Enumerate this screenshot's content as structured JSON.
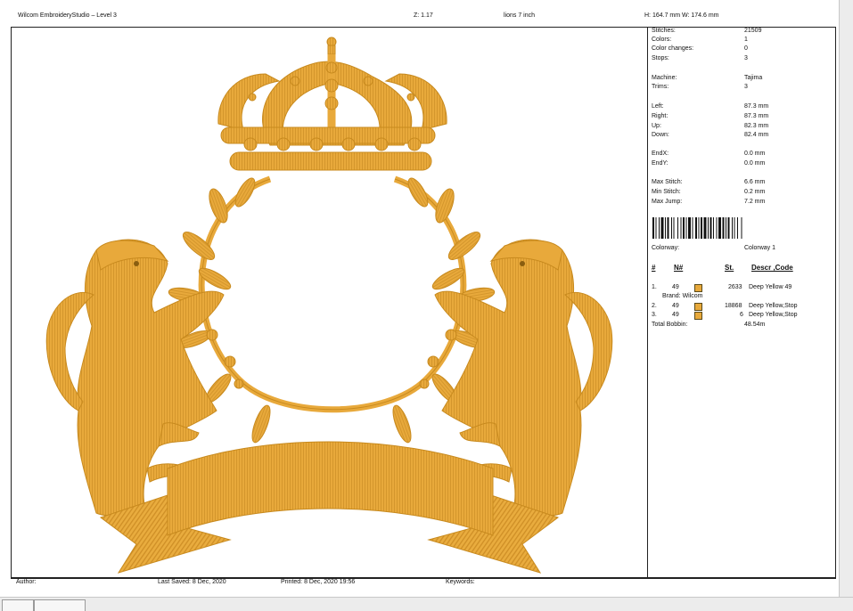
{
  "header": {
    "app_title": "Wilcom EmbroideryStudio – Level 3",
    "zoom": "Z: 1.17",
    "file_name": "lions 7 inch",
    "dimensions": "H: 164.7 mm  W: 174.6 mm"
  },
  "info": {
    "stitches_label": "Stitches:",
    "stitches_value": "21509",
    "colors_label": "Colors:",
    "colors_value": "1",
    "color_changes_label": "Color changes:",
    "color_changes_value": "0",
    "stops_label": "Stops:",
    "stops_value": "3",
    "machine_label": "Machine:",
    "machine_value": "Tajima",
    "trims_label": "Trims:",
    "trims_value": "3",
    "left_label": "Left:",
    "left_value": "87.3 mm",
    "right_label": "Right:",
    "right_value": "87.3 mm",
    "up_label": "Up:",
    "up_value": "82.3 mm",
    "down_label": "Down:",
    "down_value": "82.4 mm",
    "endx_label": "EndX:",
    "endx_value": "0.0 mm",
    "endy_label": "EndY:",
    "endy_value": "0.0 mm",
    "max_stitch_label": "Max Stitch:",
    "max_stitch_value": "6.6 mm",
    "min_stitch_label": "Min Stitch:",
    "min_stitch_value": "0.2 mm",
    "max_jump_label": "Max Jump:",
    "max_jump_value": "7.2 mm"
  },
  "colorway": {
    "label": "Colorway:",
    "value": "Colorway 1"
  },
  "table": {
    "headers": {
      "num": "#",
      "n": "N#",
      "st": "St.",
      "descr": "Descr ,Code"
    },
    "rows": [
      {
        "idx": "1.",
        "n": "49",
        "st": "2633",
        "descr": "Deep Yellow 49",
        "color": "#e8a93b"
      },
      {
        "idx": "2.",
        "n": "49",
        "st": "18868",
        "descr": "Deep Yellow,Stop",
        "color": "#e8a93b"
      },
      {
        "idx": "3.",
        "n": "49",
        "st": "6",
        "descr": "Deep Yellow,Stop",
        "color": "#e8a93b"
      }
    ],
    "brand": "Brand: Wilcom",
    "total_bobbin_label": "Total Bobbin:",
    "total_bobbin_value": "48.54m"
  },
  "footer": {
    "author": "Author:",
    "last_saved": "Last Saved:  8 Dec, 2020",
    "printed": "Printed:  8 Dec, 2020 19:56",
    "keywords": "Keywords:"
  },
  "colors": {
    "thread": "#e8a93b",
    "thread_dark": "#c88a1e",
    "thread_light": "#f5c85a"
  }
}
